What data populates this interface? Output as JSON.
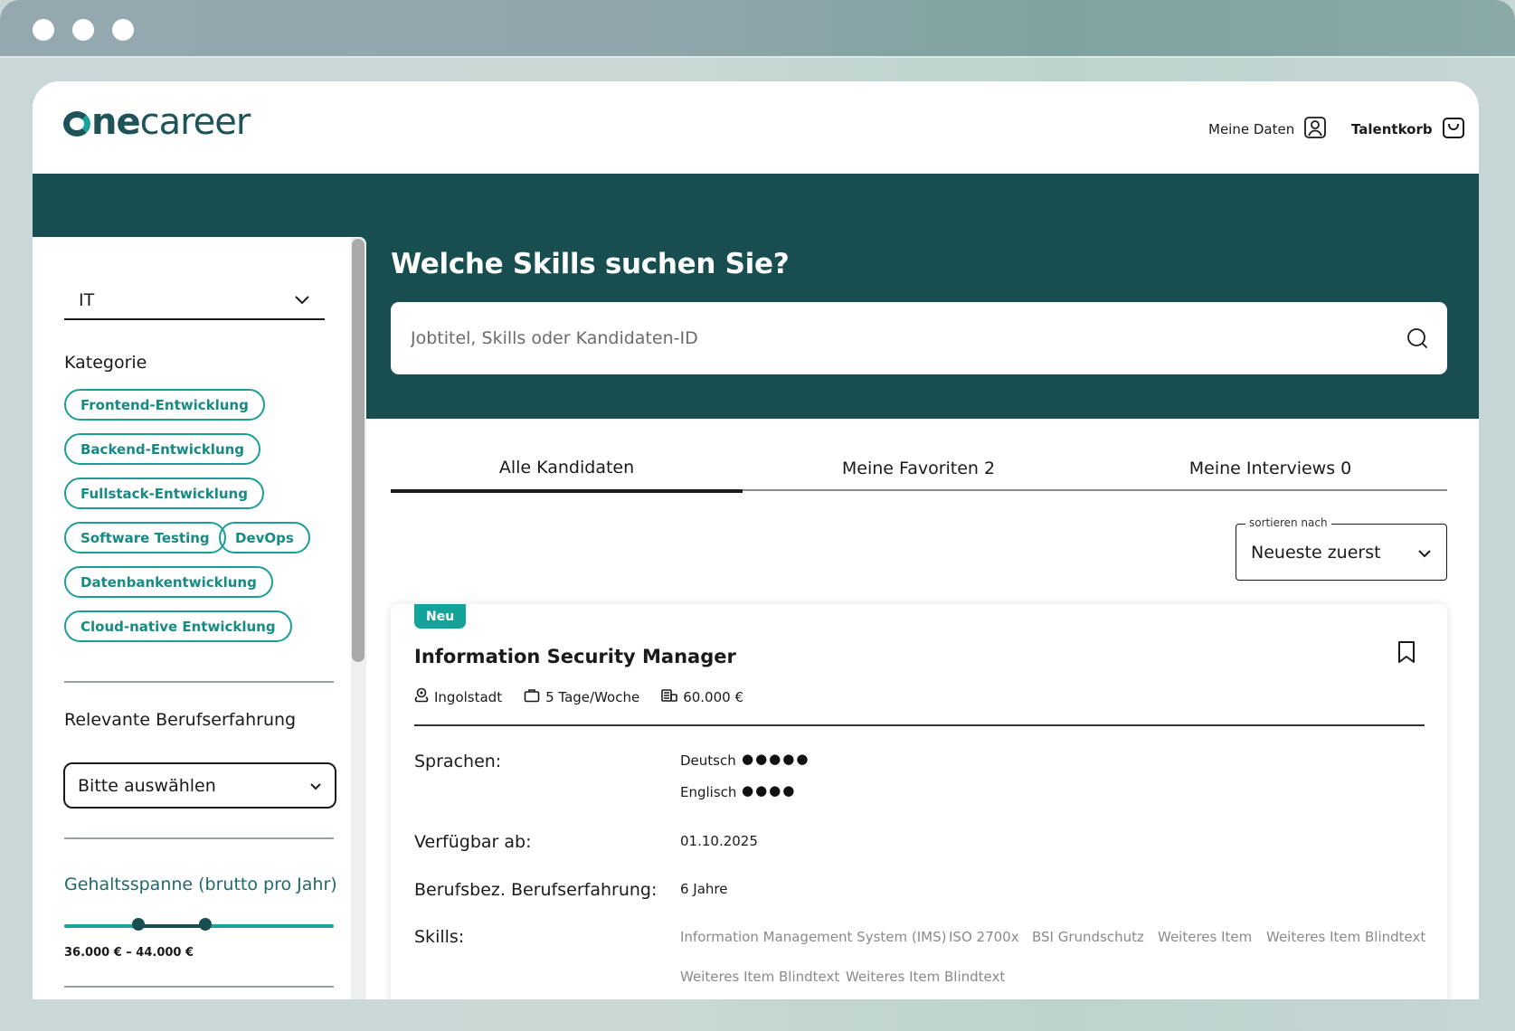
{
  "brand": {
    "logo_text": "onecareer"
  },
  "header": {
    "my_data_label": "Meine Daten",
    "talent_basket_label": "Talentkorb"
  },
  "hero": {
    "title": "Welche Skills suchen Sie?",
    "search_placeholder": "Jobtitel, Skills oder Kandidaten-ID"
  },
  "sidebar": {
    "field_select": "IT",
    "category_heading": "Kategorie",
    "categories": [
      "Frontend-Entwicklung",
      "Backend-Entwicklung",
      "Fullstack-Entwicklung",
      "Software Testing",
      "DevOps",
      "Datenbankentwicklung",
      "Cloud-native Entwicklung"
    ],
    "experience_heading": "Relevante Berufserfahrung",
    "experience_value": "Bitte auswählen",
    "salary_heading": "Gehaltsspanne (brutto pro Jahr)",
    "salary_range": "36.000 € – 44.000 €"
  },
  "tabs": [
    {
      "label": "Alle Kandidaten"
    },
    {
      "label": "Meine Favoriten 2"
    },
    {
      "label": "Meine Interviews 0"
    }
  ],
  "sort": {
    "label": "sortieren nach",
    "value": "Neueste zuerst"
  },
  "card": {
    "badge": "Neu",
    "title": "Information Security Manager",
    "location": "Ingolstadt",
    "workload": "5 Tage/Woche",
    "salary": "60.000 €",
    "languages_label": "Sprachen:",
    "languages": [
      {
        "name": "Deutsch",
        "dots": "●●●●●"
      },
      {
        "name": "Englisch",
        "dots": "●●●●"
      }
    ],
    "available_label": "Verfügbar ab:",
    "available_value": "01.10.2025",
    "experience_label": "Berufsbez. Berufserfahrung:",
    "experience_value": "6 Jahre",
    "skills_label": "Skills:",
    "skills": [
      "Information Management System (IMS)",
      "ISO 2700x",
      "BSI Grundschutz",
      "Weiteres Item",
      "Weiteres Item Blindtext",
      "Weiteres Item Blindtext",
      "Weiteres Item Blindtext"
    ]
  },
  "colors": {
    "hero": "#184e4f",
    "accent": "#13a39a",
    "text": "#1a1a1a"
  }
}
